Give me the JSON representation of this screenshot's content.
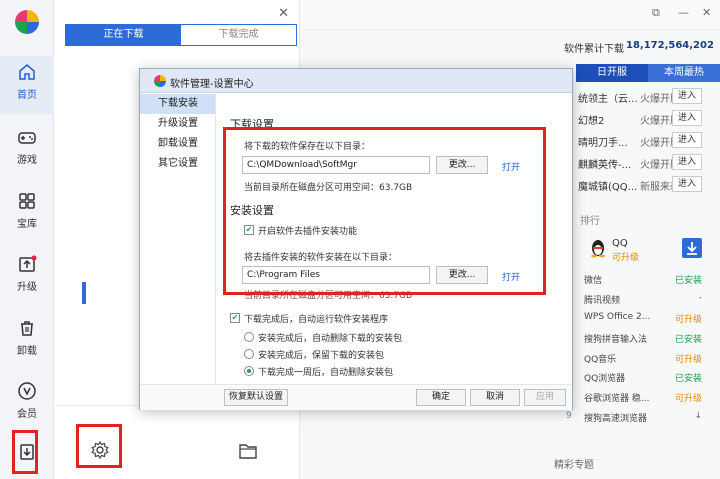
{
  "nav": {
    "items": [
      {
        "label": "首页",
        "icon": "home-icon"
      },
      {
        "label": "游戏",
        "icon": "gamepad-icon"
      },
      {
        "label": "宝库",
        "icon": "grid-icon"
      },
      {
        "label": "升级",
        "icon": "upgrade-icon"
      },
      {
        "label": "卸载",
        "icon": "trash-icon"
      },
      {
        "label": "会员",
        "icon": "vip-icon"
      }
    ],
    "download_icon": "download-icon"
  },
  "download_panel": {
    "tabs": [
      "正在下载",
      "下载完成"
    ],
    "close_glyph": "✕",
    "settings_icon": "gear-icon",
    "folder_icon": "folder-icon"
  },
  "background": {
    "total_label": "软件累计下载",
    "total_value": "18,172,564,202",
    "rank_tabs": [
      "日开服",
      "本周最热"
    ],
    "games": [
      {
        "name": "统领主（云...",
        "status": "火爆开服",
        "enter": "进入"
      },
      {
        "name": "幻想2",
        "status": "火爆开服",
        "enter": "进入"
      },
      {
        "name": "晴明刀手...",
        "status": "火爆开服",
        "enter": "进入"
      },
      {
        "name": "麒麟英传-...",
        "status": "火爆开服",
        "enter": "进入"
      },
      {
        "name": "魔城镇(QQ...",
        "status": "新服来袭",
        "enter": "进入"
      }
    ],
    "section_head": "排行",
    "qq": {
      "name": "QQ",
      "status": "可升级"
    },
    "software": [
      {
        "num": "",
        "name": "微信",
        "status": "已安装",
        "kind": "installed"
      },
      {
        "num": "",
        "name": "腾讯视频",
        "status": "-",
        "kind": "none"
      },
      {
        "num": "",
        "name": "WPS Office 2...",
        "status": "可升级",
        "kind": "up"
      },
      {
        "num": "",
        "name": "搜狗拼音输入法",
        "status": "已安装",
        "kind": "installed"
      },
      {
        "num": "",
        "name": "QQ音乐",
        "status": "可升级",
        "kind": "up"
      },
      {
        "num": "",
        "name": "QQ浏览器",
        "status": "已安装",
        "kind": "installed"
      },
      {
        "num": "",
        "name": "谷歌浏览器 稳...",
        "status": "可升级",
        "kind": "up"
      },
      {
        "num": "9",
        "name": "搜狗高速浏览器",
        "status": "↓",
        "kind": "none"
      }
    ],
    "featured": "精彩专题"
  },
  "dialog": {
    "title": "软件管理-设置中心",
    "sidebar": [
      "下载安装",
      "升级设置",
      "卸载设置",
      "其它设置"
    ],
    "download_section": "下载设置",
    "save_label": "将下载的软件保存在以下目录：",
    "save_path": "C:\\QMDownload\\SoftMgr",
    "change_label": "更改...",
    "open_label": "打开",
    "free_space": "当前目录所在磁盘分区可用空间：63.7GB",
    "install_section": "安装设置",
    "plugin_option": "开启软件去插件安装功能",
    "install_label": "将去插件安装的软件安装在以下目录：",
    "install_path": "C:\\Program Files",
    "free_space2": "当前目录所在磁盘分区可用空间：63.7GB",
    "auto_run": "下载完成后，自动运行软件安装程序",
    "radio_options": [
      "安装完成后，自动删除下载的安装包",
      "安装完成后，保留下载的安装包",
      "下载完成一周后，自动删除安装包"
    ],
    "restore_label": "恢复默认设置",
    "ok_label": "确定",
    "cancel_label": "取消",
    "apply_label": "应用"
  }
}
